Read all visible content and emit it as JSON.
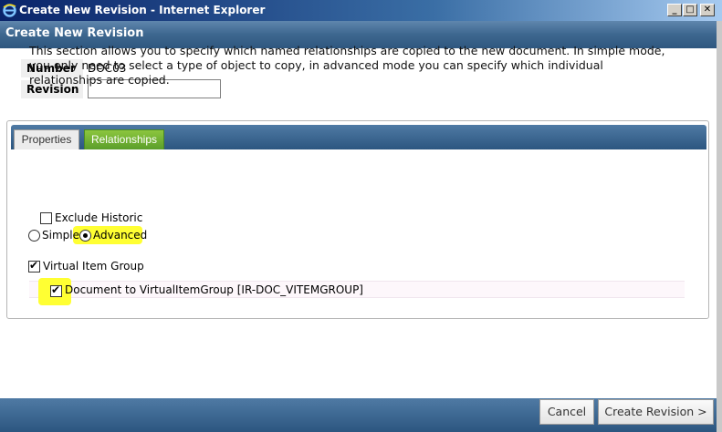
{
  "window": {
    "title": "Create New Revision - Internet Explorer",
    "min_label": "_",
    "max_label": "□",
    "close_label": "✕"
  },
  "dialog": {
    "header": "Create New Revision"
  },
  "form": {
    "number_label": "Number",
    "number_value": "DOC03",
    "revision_label": "Revision",
    "revision_value": ""
  },
  "tabs": [
    {
      "label": "Properties",
      "active": false
    },
    {
      "label": "Relationships",
      "active": true
    }
  ],
  "relationships": {
    "description": "This section allows you to specify which named relationships are copied to the new document. In simple mode, you only need to select a type of object to copy, in advanced mode you can specify which individual relationships are copied.",
    "exclude_historic_label": "Exclude Historic",
    "exclude_historic_checked": false,
    "mode_simple_label": "Simple",
    "mode_advanced_label": "Advanced",
    "selected_mode": "Advanced",
    "group_label": "Virtual Item Group",
    "group_checked": true,
    "relationship_label": "Document to VirtualItemGroup [IR-DOC_VITEMGROUP]",
    "relationship_checked": true
  },
  "footer": {
    "cancel_label": "Cancel",
    "create_label": "Create Revision >"
  },
  "colors": {
    "header_blue": "#3d678f",
    "tab_active_green": "#6aab2e",
    "highlight_yellow": "#ffff33"
  }
}
